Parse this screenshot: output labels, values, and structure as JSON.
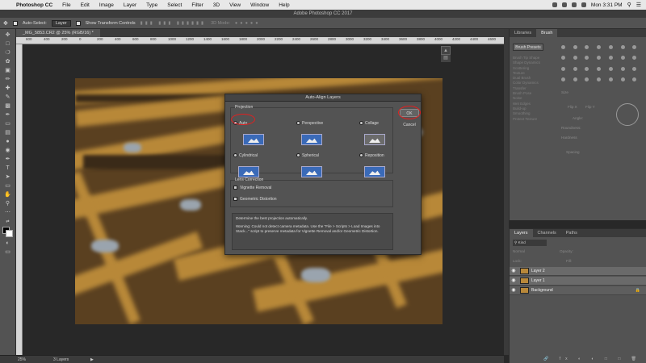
{
  "menubar": {
    "apple": "",
    "app": "Photoshop CC",
    "items": [
      "File",
      "Edit",
      "Image",
      "Layer",
      "Type",
      "Select",
      "Filter",
      "3D",
      "View",
      "Window",
      "Help"
    ],
    "clock": "Mon 3:31 PM"
  },
  "titlebar": {
    "title": "Adobe Photoshop CC 2017"
  },
  "options": {
    "auto_select": "Auto-Select:",
    "auto_select_value": "Layer",
    "show_transform": "Show Transform Controls",
    "mode_3d": "3D Mode:"
  },
  "document": {
    "tab": "_MG_5853.CR2 @ 25% (RGB/16) *"
  },
  "ruler": [
    "600",
    "400",
    "200",
    "0",
    "200",
    "400",
    "600",
    "800",
    "1000",
    "1200",
    "1400",
    "1600",
    "1800",
    "2000",
    "2200",
    "2400",
    "2600",
    "2800",
    "3000",
    "3200",
    "3400",
    "3600",
    "3800",
    "4000",
    "4200",
    "4400",
    "4600",
    "4800"
  ],
  "dialog": {
    "title": "Auto-Align Layers",
    "projection_label": "Projection",
    "options": [
      {
        "label": "Auto",
        "selected": true
      },
      {
        "label": "Perspective",
        "selected": false
      },
      {
        "label": "Collage",
        "selected": false
      },
      {
        "label": "Cylindrical",
        "selected": false
      },
      {
        "label": "Spherical",
        "selected": false
      },
      {
        "label": "Reposition",
        "selected": false
      }
    ],
    "lens_label": "Lens Correction",
    "vignette": "Vignette Removal",
    "geometric": "Geometric Distortion",
    "message_1": "Determine the best projection automatically.",
    "message_2": "Warning: Could not detect camera metadata. Use the \"File > Scripts > Load Images into Stack...\" script to preserve metadata for Vignette Removal and/or Geometric Distortion.",
    "ok_label": "OK",
    "cancel_label": "Cancel"
  },
  "brush_panel": {
    "tabs": [
      "Libraries",
      "Brush"
    ],
    "presets_button": "Brush Presets",
    "options": [
      "Brush Tip Shape",
      "Shape Dynamics",
      "Scattering",
      "Texture",
      "Dual Brush",
      "Color Dynamics",
      "Transfer",
      "Brush Pose",
      "Noise",
      "Wet Edges",
      "Build-up",
      "Smoothing",
      "Protect Texture"
    ],
    "size_label": "Size",
    "flip_x": "Flip X",
    "flip_y": "Flip Y",
    "angle": "Angle:",
    "roundness": "Roundness:",
    "hardness": "Hardness",
    "spacing": "Spacing"
  },
  "layers_panel": {
    "tabs": [
      "Layers",
      "Channels",
      "Paths"
    ],
    "kind": "Kind",
    "blend": "Normal",
    "opacity": "Opacity:",
    "lock": "Lock:",
    "fill": "Fill:",
    "layers": [
      "Layer 2",
      "Layer 1",
      "Background"
    ]
  },
  "status": {
    "zoom": "25%",
    "info": "3 Layers"
  },
  "colors": {
    "accent": "#3266c7",
    "highlight_circle": "#e02020"
  }
}
